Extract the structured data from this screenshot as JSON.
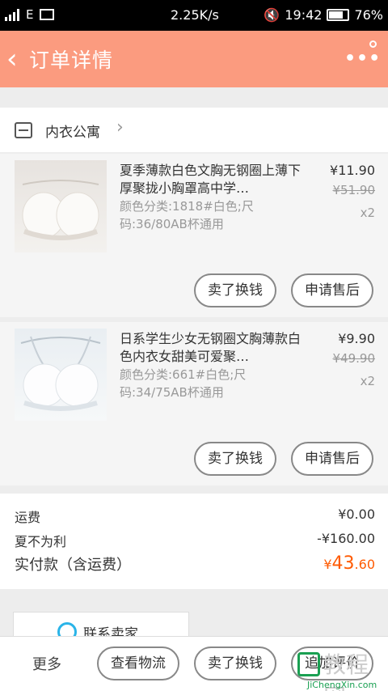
{
  "status_bar": {
    "speed": "2.25K/s",
    "time": "19:42",
    "battery": "76%",
    "battery_level": 0.76
  },
  "header": {
    "back_icon": "‹",
    "title": "订单详情",
    "more_icon": "•••"
  },
  "shop": {
    "name": "内衣公寓",
    "arrow": "›"
  },
  "items": [
    {
      "title": "夏季薄款白色文胸无钢圈上薄下厚聚拢小胸罩高中学…",
      "spec": "颜色分类:1818#白色;尺码:36/80AB杯通用",
      "price": "¥11.90",
      "original_price": "¥51.90",
      "qty": "x2",
      "buttons": [
        "卖了换钱",
        "申请售后"
      ]
    },
    {
      "title": "日系学生少女无钢圈文胸薄款白色内衣女甜美可爱聚…",
      "spec": "颜色分类:661#白色;尺码:34/75AB杯通用",
      "price": "¥9.90",
      "original_price": "¥49.90",
      "qty": "x2",
      "buttons": [
        "卖了换钱",
        "申请售后"
      ]
    }
  ],
  "summary": {
    "shipping_label": "运费",
    "shipping_value": "¥0.00",
    "discount_label": "夏不为利",
    "discount_value": "-¥160.00",
    "paid_label": "实付款（含运费）",
    "paid_currency": "¥",
    "paid_integer": "43",
    "paid_decimal": ".60"
  },
  "contact": {
    "label": "联系卖家"
  },
  "bottom_bar": {
    "more": "更多",
    "buttons": [
      "查看物流",
      "卖了换钱",
      "追加评价"
    ]
  },
  "watermark": {
    "text": "教程网",
    "url": "JiChengXin.com"
  },
  "colors": {
    "header": "#fb9b7f",
    "price_accent": "#ff5a00"
  }
}
